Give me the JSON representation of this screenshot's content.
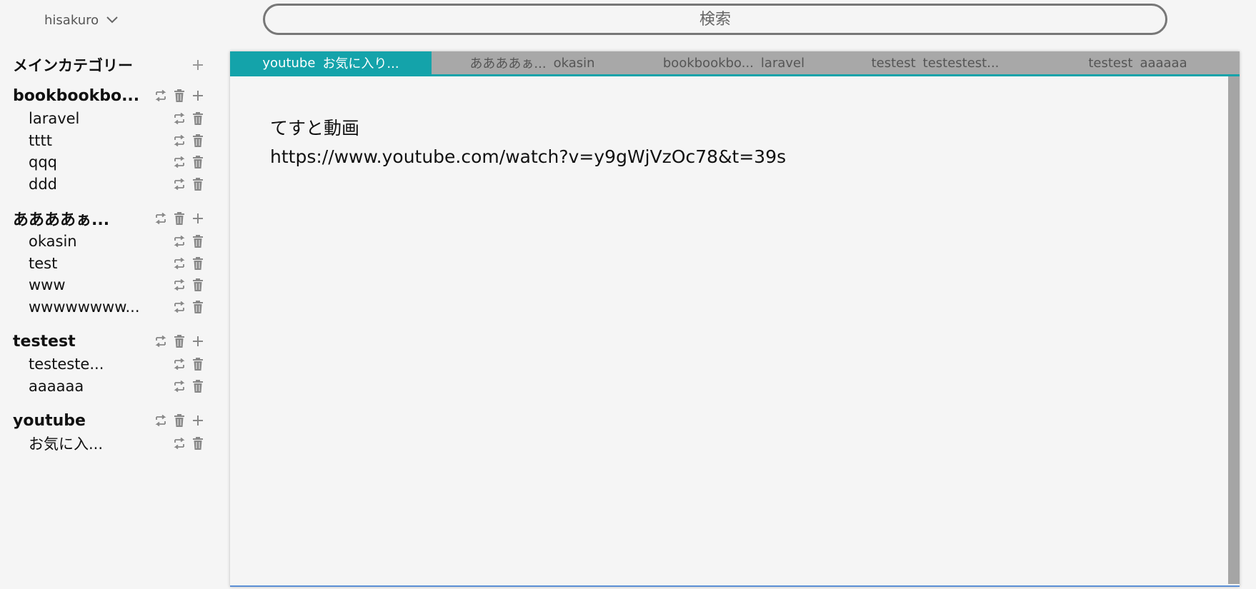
{
  "header": {
    "username": "hisakuro",
    "search_placeholder": "検索"
  },
  "sidebar": {
    "title": "メインカテゴリー",
    "categories": [
      {
        "name": "bookbookbo...",
        "subs": [
          "laravel",
          "tttt",
          "qqq",
          "ddd"
        ]
      },
      {
        "name": "ああああぁ...",
        "subs": [
          "okasin",
          "test",
          "www",
          "wwwwwwww..."
        ]
      },
      {
        "name": "testest",
        "subs": [
          "testeste...",
          "aaaaaa"
        ]
      },
      {
        "name": "youtube",
        "subs": [
          "お気に入..."
        ]
      }
    ]
  },
  "tabs": [
    {
      "category": "youtube",
      "sub": "お気に入り...",
      "active": true
    },
    {
      "category": "ああああぁ...",
      "sub": "okasin",
      "active": false
    },
    {
      "category": "bookbookbo...",
      "sub": "laravel",
      "active": false
    },
    {
      "category": "testest",
      "sub": "testestest...",
      "active": false
    },
    {
      "category": "testest",
      "sub": "aaaaaa",
      "active": false
    }
  ],
  "note": {
    "lines": [
      "てすと動画",
      "https://www.youtube.com/watch?v=y9gWjVzOc78&t=39s"
    ]
  },
  "colors": {
    "accent": "#14a3aa",
    "tab_bar": "#a8a8a8",
    "icon": "#888888",
    "background": "#f5f5f5"
  },
  "icons": {
    "rename": "swap-arrows-icon",
    "delete": "trash-icon",
    "add": "plus-icon",
    "dropdown": "chevron-down-icon"
  }
}
